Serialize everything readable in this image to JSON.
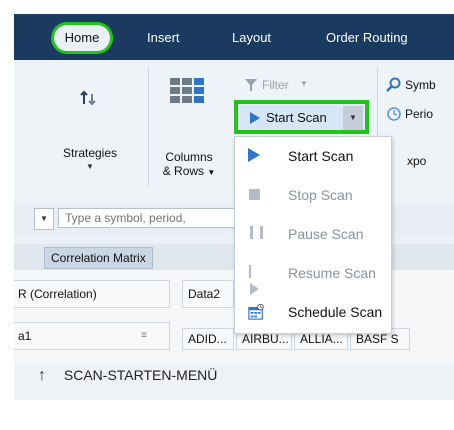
{
  "ribbon_tabs": [
    "Home",
    "Insert",
    "Layout",
    "Order Routing"
  ],
  "groups": {
    "strategies": "Strategies",
    "columns_rows_line1": "Columns",
    "columns_rows_line2": "& Rows",
    "filter": "Filter",
    "start_scan": "Start Scan",
    "symbol": "Symb",
    "period": "Perio",
    "export": "xpo"
  },
  "search": {
    "placeholder": "Type a symbol, period,"
  },
  "window_tab": "Correlation Matrix",
  "grid": {
    "header_left": "R (Correlation)",
    "header_data2": "Data2",
    "row_label": "a1",
    "columns": [
      "ADID...",
      "AIRBU...",
      "ALLIA...",
      "BASF S"
    ]
  },
  "menu": {
    "items": [
      {
        "label": "Start Scan",
        "enabled": true,
        "icon": "play-icon"
      },
      {
        "label": "Stop Scan",
        "enabled": false,
        "icon": "stop-icon"
      },
      {
        "label": "Pause Scan",
        "enabled": false,
        "icon": "pause-icon"
      },
      {
        "label": "Resume Scan",
        "enabled": false,
        "icon": "resume-icon"
      },
      {
        "label": "Schedule Scan",
        "enabled": true,
        "icon": "calendar-icon"
      }
    ]
  },
  "caption": "SCAN-STARTEN-MENÜ",
  "colors": {
    "highlight": "#22c41c",
    "ribbon_dark": "#1b3a60",
    "accent_blue": "#2e74c8"
  }
}
